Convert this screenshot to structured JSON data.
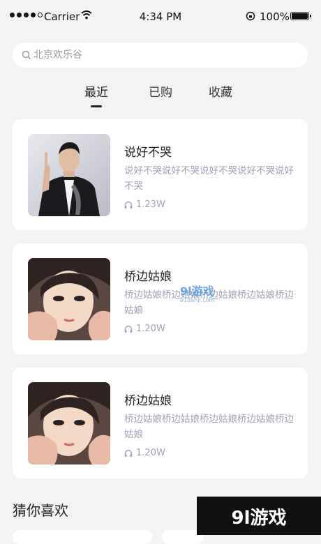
{
  "status_bar": {
    "carrier": "Carrier",
    "time": "4:34 PM",
    "battery": "100%"
  },
  "search": {
    "placeholder": "北京欢乐谷"
  },
  "tabs": [
    {
      "label": "最近",
      "active": true
    },
    {
      "label": "已购",
      "active": false
    },
    {
      "label": "收藏",
      "active": false
    }
  ],
  "items": [
    {
      "title": "说好不哭",
      "desc": "说好不哭说好不哭说好不哭说好不哭说好不哭",
      "plays": "1.23W",
      "cover": "portrait-singer"
    },
    {
      "title": "桥边姑娘",
      "desc": "桥边姑娘桥边姑娘桥边姑娘桥边姑娘桥边姑娘",
      "plays": "1.20W",
      "cover": "illustrated-girl"
    },
    {
      "title": "桥边姑娘",
      "desc": "桥边姑娘桥边姑娘桥边姑娘桥边姑娘桥边姑娘",
      "plays": "1.20W",
      "cover": "illustrated-girl"
    }
  ],
  "section": {
    "title": "猜你喜欢"
  },
  "watermark": {
    "center": "9l游戏",
    "center_sub": "91danji.com",
    "corner": "9l游戏"
  },
  "colors": {
    "background": "#f3f3f6",
    "card": "#ffffff",
    "muted_text": "#9fa3b6"
  }
}
